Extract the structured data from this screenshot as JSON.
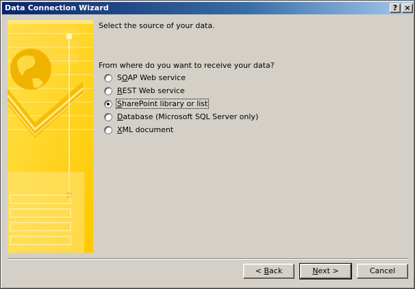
{
  "window": {
    "title": "Data Connection Wizard",
    "help_button": "?",
    "close_button": "×"
  },
  "heading": "Select the source of your data.",
  "question": "From where do you want to receive your data?",
  "options": [
    {
      "text_before": "S",
      "accel": "O",
      "text_after": "AP Web service",
      "checked": false
    },
    {
      "text_before": "",
      "accel": "R",
      "text_after": "EST Web service",
      "checked": false
    },
    {
      "text_before": "",
      "accel": "S",
      "text_after": "harePoint library or list",
      "checked": true
    },
    {
      "text_before": "",
      "accel": "D",
      "text_after": "atabase (Microsoft SQL Server only)",
      "checked": false
    },
    {
      "text_before": "",
      "accel": "X",
      "text_after": "ML document",
      "checked": false
    }
  ],
  "buttons": {
    "back": {
      "before": "< ",
      "accel": "B",
      "after": "ack"
    },
    "next": {
      "before": "",
      "accel": "N",
      "after": "ext >"
    },
    "cancel": {
      "before": "Cancel",
      "accel": "",
      "after": ""
    }
  },
  "colors": {
    "accent_yellow": "#ffd200",
    "titlebar_start": "#0a246a",
    "titlebar_end": "#a6caf0"
  }
}
